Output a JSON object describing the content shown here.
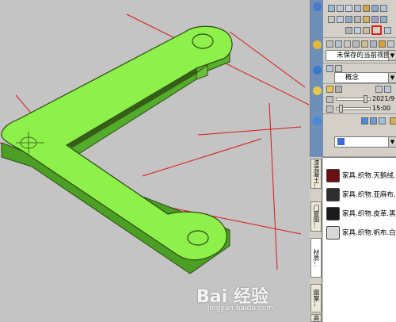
{
  "colors": {
    "viewport_bg": "#c4c4c4",
    "object_fill": "#8ef04a",
    "object_edge": "#2c4a12",
    "axis_line": "#d81818",
    "panel_bg": "#d4d0c8",
    "strip_bg": "#6d8fb8",
    "highlight": "#e0201a"
  },
  "view_panel": {
    "named_view": "未保存的当前视图"
  },
  "visual_style_panel": {
    "style_value": "概念"
  },
  "sun_panel": {
    "date_value": "2021/9",
    "time_value": "15:00"
  },
  "layer_panel": {
    "current_value": ""
  },
  "tabs": [
    "高级材...",
    "门窗图...",
    "图案...",
    "材质...",
    "漆混凝土..."
  ],
  "materials": [
    {
      "label": "家具.织物.天鹅绒...",
      "color": "#6a1010"
    },
    {
      "label": "家具.织物.亚麻布...",
      "color": "#2e2e2e"
    },
    {
      "label": "家具.织物.皮革.黑色",
      "color": "#1a1a1a"
    },
    {
      "label": "家具.织物.帆布.白色",
      "color": "#d8d8d8"
    }
  ],
  "watermark": {
    "brand_text": "Bai 经验",
    "url_text": "jingyan.baidu.com"
  }
}
